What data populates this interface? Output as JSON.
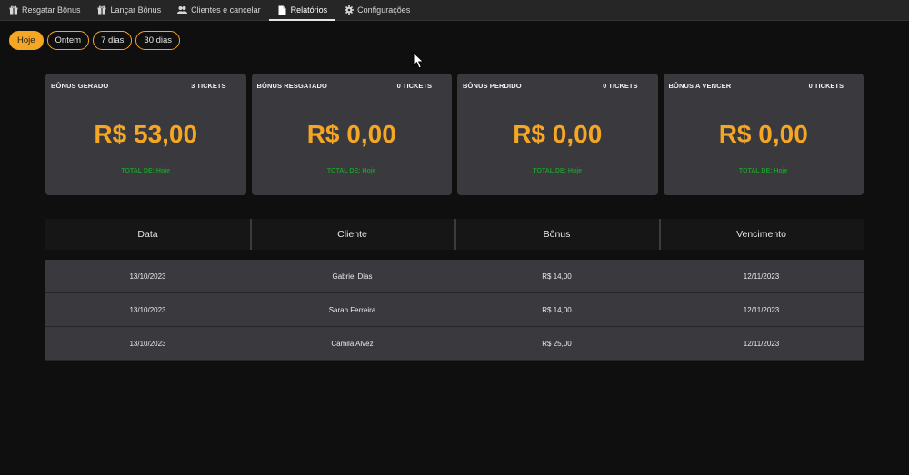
{
  "nav": {
    "items": [
      {
        "label": "Resgatar Bônus",
        "icon": "gift-icon"
      },
      {
        "label": "Lançar Bônus",
        "icon": "gift-icon"
      },
      {
        "label": "Clientes e cancelar",
        "icon": "users-icon"
      },
      {
        "label": "Relatórios",
        "icon": "document-icon"
      },
      {
        "label": "Configurações",
        "icon": "gear-icon"
      }
    ],
    "active_index": 3
  },
  "filters": {
    "options": [
      "Hoje",
      "Ontem",
      "7 dias",
      "30 dias"
    ],
    "selected": "Hoje"
  },
  "cards": [
    {
      "label": "BÔNUS GERADO",
      "tickets": "3 TICKETS",
      "amount": "R$ 53,00",
      "total": "TOTAL DE: Hoje"
    },
    {
      "label": "BÔNUS RESGATADO",
      "tickets": "0 TICKETS",
      "amount": "R$ 0,00",
      "total": "TOTAL DE: Hoje"
    },
    {
      "label": "BÔNUS PERDIDO",
      "tickets": "0 TICKETS",
      "amount": "R$ 0,00",
      "total": "TOTAL DE: Hoje"
    },
    {
      "label": "BÔNUS A VENCER",
      "tickets": "0 TICKETS",
      "amount": "R$ 0,00",
      "total": "TOTAL DE: Hoje"
    }
  ],
  "table": {
    "columns": [
      "Data",
      "Cliente",
      "Bônus",
      "Vencimento"
    ],
    "rows": [
      [
        "13/10/2023",
        "Gabriel Dias",
        "R$ 14,00",
        "12/11/2023"
      ],
      [
        "13/10/2023",
        "Sarah Ferreira",
        "R$ 14,00",
        "12/11/2023"
      ],
      [
        "13/10/2023",
        "Camila Alvez",
        "R$ 25,00",
        "12/11/2023"
      ]
    ]
  },
  "colors": {
    "accent": "#f5a623",
    "total_green": "#1e9a2a",
    "card_bg": "#3a393e",
    "nav_bg": "#262626",
    "page_bg": "#0f0f0f"
  }
}
